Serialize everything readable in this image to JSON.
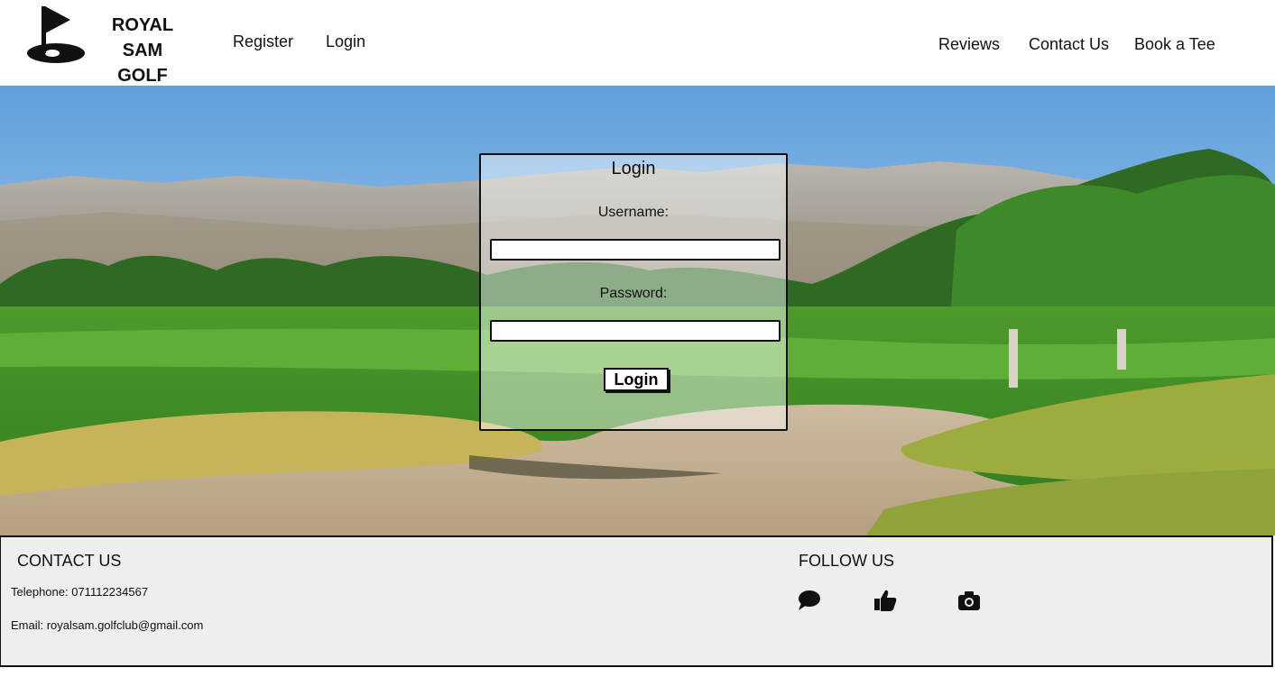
{
  "header": {
    "logo_line1": "ROYAL SAM",
    "logo_line2": "GOLF CLUB",
    "nav_left": [
      "Register",
      "Login"
    ],
    "nav_right": [
      "Reviews",
      "Contact Us",
      "Book a Tee"
    ]
  },
  "login": {
    "title": "Login",
    "username_label": "Username:",
    "username_value": "",
    "password_label": "Password:",
    "password_value": "",
    "submit_label": "Login"
  },
  "footer": {
    "contact_heading": "CONTACT US",
    "telephone": "Telephone: 071112234567",
    "email": "Email: royalsam.golfclub@gmail.com",
    "follow_heading": "FOLLOW US",
    "social_icons": [
      "chat-bubble-icon",
      "thumbs-up-icon",
      "camera-icon"
    ]
  },
  "colors": {
    "sky": "#7fb6e6",
    "grass": "#3f8f2a",
    "sand": "#c9b596",
    "footer_bg": "#eeeeee"
  }
}
